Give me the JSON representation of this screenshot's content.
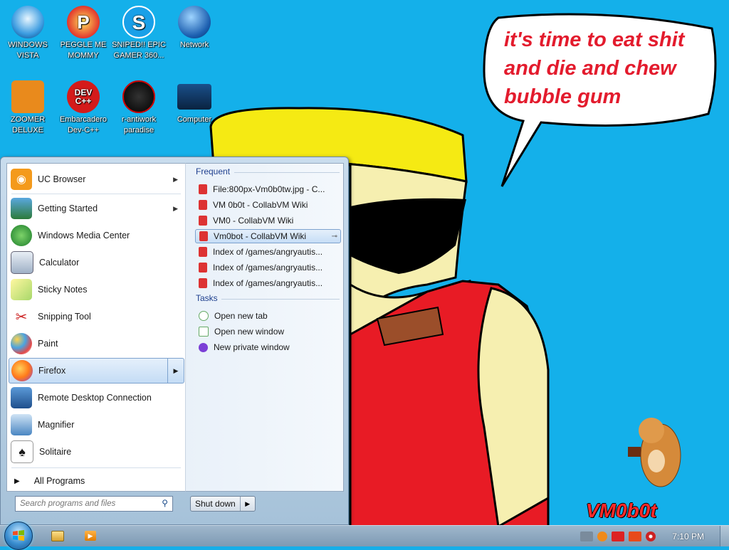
{
  "desktop": {
    "icons": [
      {
        "label": "WINDOWS VISTA",
        "icon": "vista-globe-icon"
      },
      {
        "label": "PEGGLE ME MOMMY",
        "icon": "peggle-icon"
      },
      {
        "label": "SNIPED!! EPIC GAMER 360...",
        "icon": "skype-icon"
      },
      {
        "label": "Network",
        "icon": "network-icon"
      },
      {
        "label": "ZOOMER DELUXE",
        "icon": "zoomer-icon"
      },
      {
        "label": "Embarcadero Dev-C++",
        "icon": "devcpp-icon"
      },
      {
        "label": "r-antiwork paradise",
        "icon": "antiwork-icon"
      },
      {
        "label": "Computer",
        "icon": "computer-icon"
      }
    ],
    "devcpp_badge": "DEV C++",
    "wallpaper_text": "it's time to eat shit and die and chew bubble gum",
    "watermark": "VM0b0t"
  },
  "start_menu": {
    "programs": [
      {
        "label": "UC Browser",
        "icon": "uc-browser-icon",
        "has_submenu": true
      },
      {
        "label": "Getting Started",
        "icon": "getting-started-icon",
        "has_submenu": true
      },
      {
        "label": "Windows Media Center",
        "icon": "media-center-icon",
        "has_submenu": false
      },
      {
        "label": "Calculator",
        "icon": "calculator-icon",
        "has_submenu": false
      },
      {
        "label": "Sticky Notes",
        "icon": "sticky-notes-icon",
        "has_submenu": false
      },
      {
        "label": "Snipping Tool",
        "icon": "snipping-tool-icon",
        "has_submenu": false
      },
      {
        "label": "Paint",
        "icon": "paint-icon",
        "has_submenu": false
      },
      {
        "label": "Firefox",
        "icon": "firefox-icon",
        "has_submenu": true
      },
      {
        "label": "Remote Desktop Connection",
        "icon": "remote-desktop-icon",
        "has_submenu": false
      },
      {
        "label": "Magnifier",
        "icon": "magnifier-icon",
        "has_submenu": false
      },
      {
        "label": "Solitaire",
        "icon": "solitaire-icon",
        "has_submenu": false
      }
    ],
    "all_programs": "All Programs",
    "search_placeholder": "Search programs and files",
    "shutdown_label": "Shut down",
    "jumplist": {
      "frequent_header": "Frequent",
      "frequent": [
        "File:800px-Vm0b0tw.jpg - C...",
        "VM 0b0t - CollabVM Wiki",
        "VM0 - CollabVM Wiki",
        "Vm0bot - CollabVM Wiki",
        "Index of /games/angryautis...",
        "Index of /games/angryautis...",
        "Index of /games/angryautis..."
      ],
      "tasks_header": "Tasks",
      "tasks": [
        "Open new tab",
        "Open new window",
        "New private window"
      ]
    }
  },
  "taskbar": {
    "clock": "7:10 PM"
  },
  "colors": {
    "desktop_bg": "#14b0ea",
    "speech_text": "#e31b2d",
    "firefox_orange": "#ff7a1a"
  }
}
